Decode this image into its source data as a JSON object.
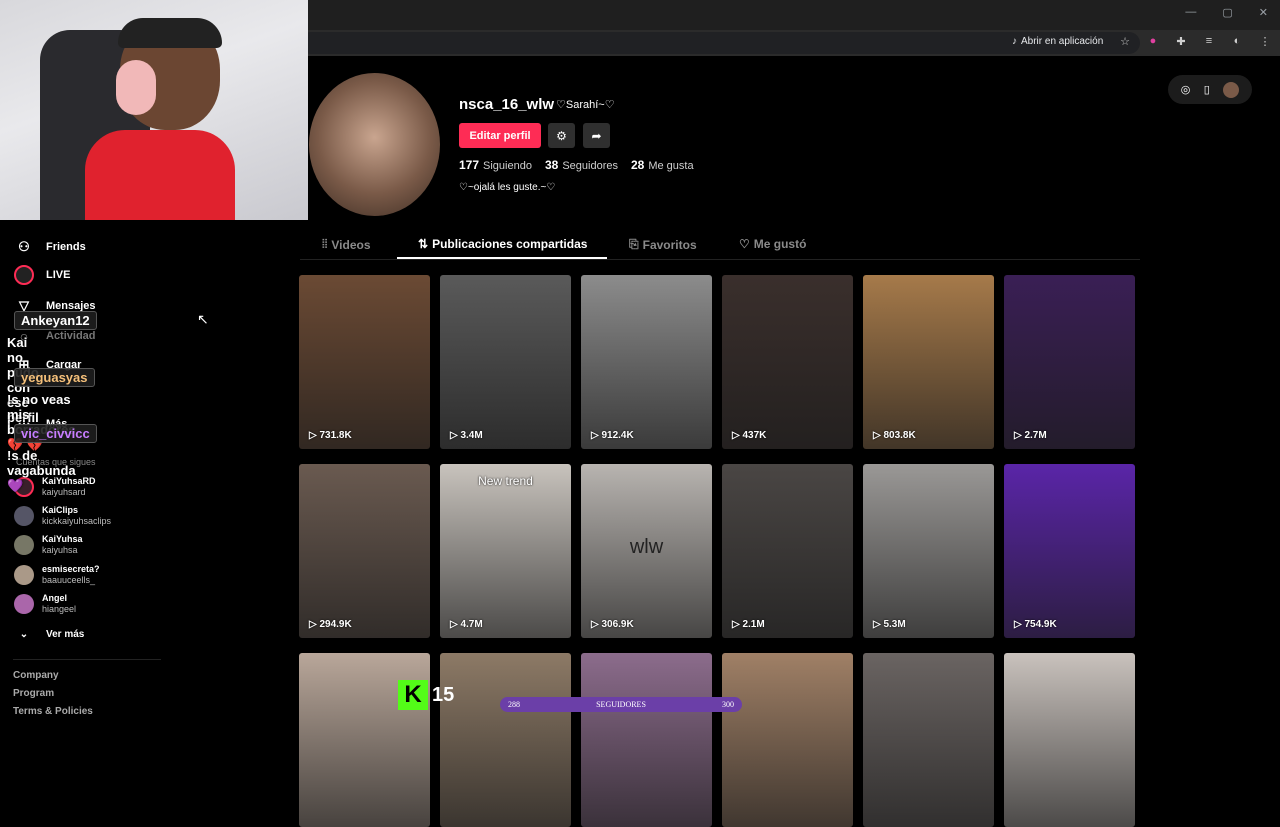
{
  "browser": {
    "open_in_app": "Abrir en aplicación"
  },
  "sidebar": {
    "items": [
      {
        "label": "Friends",
        "icon": "friends-icon"
      },
      {
        "label": "LIVE",
        "icon": "live-icon"
      },
      {
        "label": "Mensajes",
        "icon": "messages-icon"
      },
      {
        "label": "Actividad",
        "icon": "activity-icon"
      },
      {
        "label": "Cargar",
        "icon": "upload-icon"
      },
      {
        "label": "Más",
        "icon": "more-icon"
      }
    ],
    "following_title": "Cuentas que sigues",
    "following": [
      {
        "name": "KaiYuhsaRD",
        "user": "kaiyuhsard"
      },
      {
        "name": "KaiClips",
        "user": "kickkaiyuhsaclips"
      },
      {
        "name": "KaiYuhsa",
        "user": "kaiyuhsa"
      },
      {
        "name": "esmisecreta?",
        "user": "baauuceells_"
      },
      {
        "name": "Angel",
        "user": "hiangeel"
      }
    ],
    "see_more": "Ver más",
    "footer": [
      "Company",
      "Program",
      "Terms & Policies"
    ]
  },
  "chat": [
    {
      "user": "Ankeyan12",
      "message": "Kai no pudo con ese perfil",
      "color": "#ffffff"
    },
    {
      "user": "yeguasyas",
      "message": "!s no veas mis borradores 💔 💔",
      "color": "#f5c07a"
    },
    {
      "user": "vic_civvicc",
      "message": "!s de vagabunda 💜",
      "color": "#c77dff"
    }
  ],
  "profile": {
    "username": "nsca_16_wlw",
    "nickname": "♡Sarahí~♡",
    "edit_button": "Editar perfil",
    "following_count": "177",
    "following_label": "Siguiendo",
    "followers_count": "38",
    "followers_label": "Seguidores",
    "likes_count": "28",
    "likes_label": "Me gusta",
    "bio": "♡~ojalá les guste.~♡"
  },
  "tabs": [
    {
      "label": "Videos",
      "icon": "grid-icon"
    },
    {
      "label": "Publicaciones compartidas",
      "icon": "repost-icon"
    },
    {
      "label": "Favoritos",
      "icon": "bookmark-icon"
    },
    {
      "label": "Me gustó",
      "icon": "heart-icon"
    }
  ],
  "videos": [
    {
      "views": "731.8K",
      "bg": "#6b4a34"
    },
    {
      "views": "3.4M",
      "bg": "#5a5a5a"
    },
    {
      "views": "912.4K",
      "bg": "#8c8c8c"
    },
    {
      "views": "437K",
      "bg": "#3a2f2c"
    },
    {
      "views": "803.8K",
      "bg": "#a67a4a"
    },
    {
      "views": "2.7M",
      "bg": "#3a1f55"
    },
    {
      "views": "294.9K",
      "bg": "#6a5a50"
    },
    {
      "views": "4.7M",
      "bg": "#c8c3bd",
      "overlay": "New trend"
    },
    {
      "views": "306.9K",
      "bg": "#b8b4b0",
      "overlay": "wlw"
    },
    {
      "views": "2.1M",
      "bg": "#4a4644"
    },
    {
      "views": "5.3M",
      "bg": "#9a9896"
    },
    {
      "views": "754.9K",
      "bg": "#5a25a8"
    },
    {
      "views": "",
      "bg": "#b9a79a"
    },
    {
      "views": "",
      "bg": "#8d7a66"
    },
    {
      "views": "",
      "bg": "#8c6c8c"
    },
    {
      "views": "",
      "bg": "#a08066"
    },
    {
      "views": "",
      "bg": "#6a6462"
    },
    {
      "views": "",
      "bg": "#c9c2bd"
    }
  ],
  "stream": {
    "badge_number": "15",
    "goal_start": "288",
    "goal_label": "SEGUIDORES",
    "goal_end": "300"
  }
}
